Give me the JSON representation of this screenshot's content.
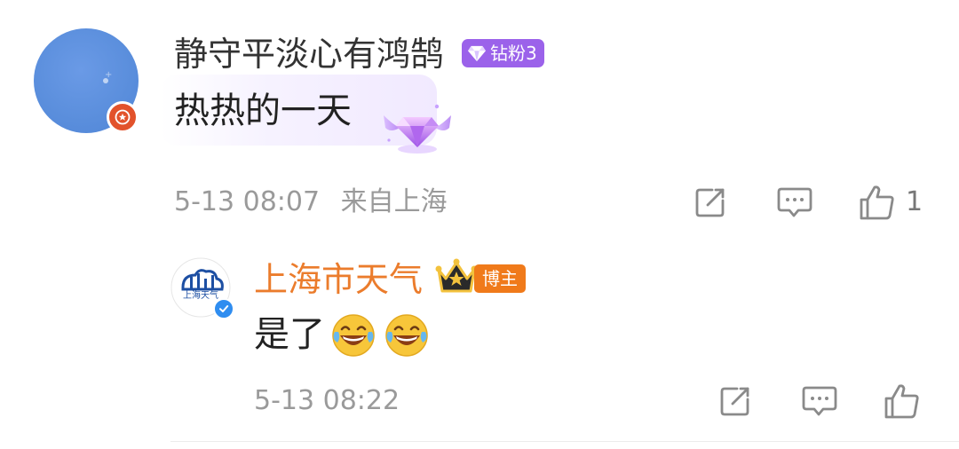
{
  "comment": {
    "username": "静守平淡心有鸿鹄",
    "fan_badge": {
      "label": "钻粉3",
      "color": "#9b62ea"
    },
    "text": "热热的一天",
    "timestamp": "5-13 08:07",
    "location": "来自上海",
    "like_count": "1",
    "icons": [
      "edit-icon",
      "comment-icon",
      "like-icon",
      "diamond-icon",
      "star-badge-icon"
    ]
  },
  "reply": {
    "username": "上海市天气",
    "username_color": "#eb7c2c",
    "blogger_badge": "博主",
    "avatar_text": "上海天气",
    "text": "是了",
    "emojis": [
      "laugh-cry-emoji",
      "laugh-cry-emoji"
    ],
    "timestamp": "5-13 08:22",
    "icons": [
      "edit-icon",
      "comment-icon",
      "like-icon",
      "crown-icon",
      "verified-icon"
    ]
  },
  "colors": {
    "meta_text": "#9a9a9a",
    "verified_blue": "#2f8df0",
    "official_red": "#e2522b",
    "blogger_orange": "#f07a1a"
  }
}
